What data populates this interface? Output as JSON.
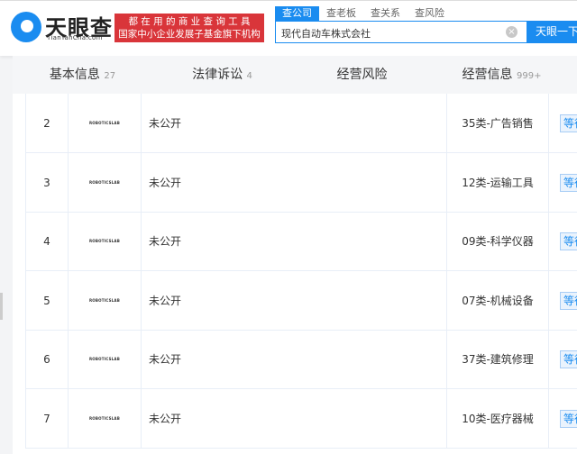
{
  "header": {
    "brand": "天眼查",
    "domain": "TianYanCha.com",
    "slogan_line1": "都 在 用 的 商 业 查 询 工 具",
    "slogan_line2": "国家中小企业发展子基金旗下机构",
    "tabs": [
      "查公司",
      "查老板",
      "查关系",
      "查风险"
    ],
    "search_value": "现代自动车株式会社",
    "search_button": "天眼一下",
    "clear_icon": "×"
  },
  "nav": [
    {
      "label": "基本信息",
      "count": "27"
    },
    {
      "label": "法律诉讼",
      "count": "4"
    },
    {
      "label": "经营风险",
      "count": ""
    },
    {
      "label": "经营信息",
      "count": "999+"
    }
  ],
  "rows": [
    {
      "no": "2",
      "logo": "ROBOTICSLAB",
      "name": "未公开",
      "class": "35类-广告销售",
      "status": "等待"
    },
    {
      "no": "3",
      "logo": "ROBOTICSLAB",
      "name": "未公开",
      "class": "12类-运输工具",
      "status": "等待"
    },
    {
      "no": "4",
      "logo": "ROBOTICSLAB",
      "name": "未公开",
      "class": "09类-科学仪器",
      "status": "等待"
    },
    {
      "no": "5",
      "logo": "ROBOTICSLAB",
      "name": "未公开",
      "class": "07类-机械设备",
      "status": "等待"
    },
    {
      "no": "6",
      "logo": "ROBOTICSLAB",
      "name": "未公开",
      "class": "37类-建筑修理",
      "status": "等待"
    },
    {
      "no": "7",
      "logo": "ROBOTICSLAB",
      "name": "未公开",
      "class": "10类-医疗器械",
      "status": "等待"
    }
  ]
}
